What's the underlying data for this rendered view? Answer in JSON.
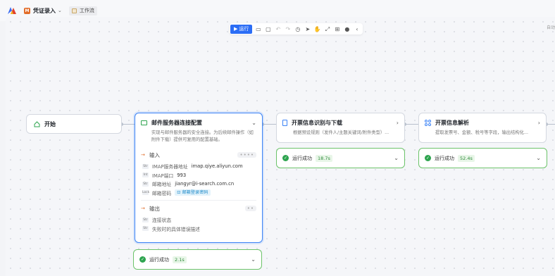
{
  "header": {
    "app_badge": "M",
    "app_title": "凭证录入",
    "tab_label": "工作流"
  },
  "toolbar": {
    "run_label": "运行",
    "right_label": "自动"
  },
  "nodes": {
    "start": {
      "title": "开始"
    },
    "mail": {
      "title": "邮件服务器连接配置",
      "desc": "实现与邮件服务器的安全连接。为后续邮件操作（如附件下载）提供可复用的配置基础。",
      "input_label": "输入",
      "output_label": "输出",
      "inputs": [
        {
          "type": "Str",
          "name": "IMAP服务器地址",
          "value": "imap.qiye.aliyun.com"
        },
        {
          "type": "Int",
          "name": "IMAP端口",
          "value": "993"
        },
        {
          "type": "Str",
          "name": "邮箱地址",
          "value": "jiangyr@i-search.com.cn"
        },
        {
          "type": "Lock",
          "name": "邮箱密码",
          "value": "邮箱登录密码"
        }
      ],
      "outputs": [
        {
          "type": "Str",
          "name": "连接状态"
        },
        {
          "type": "Str",
          "name": "失败时的具体错误描述"
        }
      ],
      "status": {
        "text": "运行成功",
        "time": "2.1s"
      }
    },
    "invoice_dl": {
      "title": "开票信息识别与下载",
      "desc": "根据预设规则（发件人/主题关键词/附件类型）...",
      "status": {
        "text": "运行成功",
        "time": "18.7s"
      }
    },
    "invoice_parse": {
      "title": "开票信息解析",
      "desc": "提取发票号、金额、税号等字段，输出结构化...",
      "status": {
        "text": "运行成功",
        "time": "52.4s"
      }
    }
  },
  "colors": {
    "accent": "#3c83f6",
    "success": "#2ea44f",
    "success_border": "#6cc36a"
  }
}
